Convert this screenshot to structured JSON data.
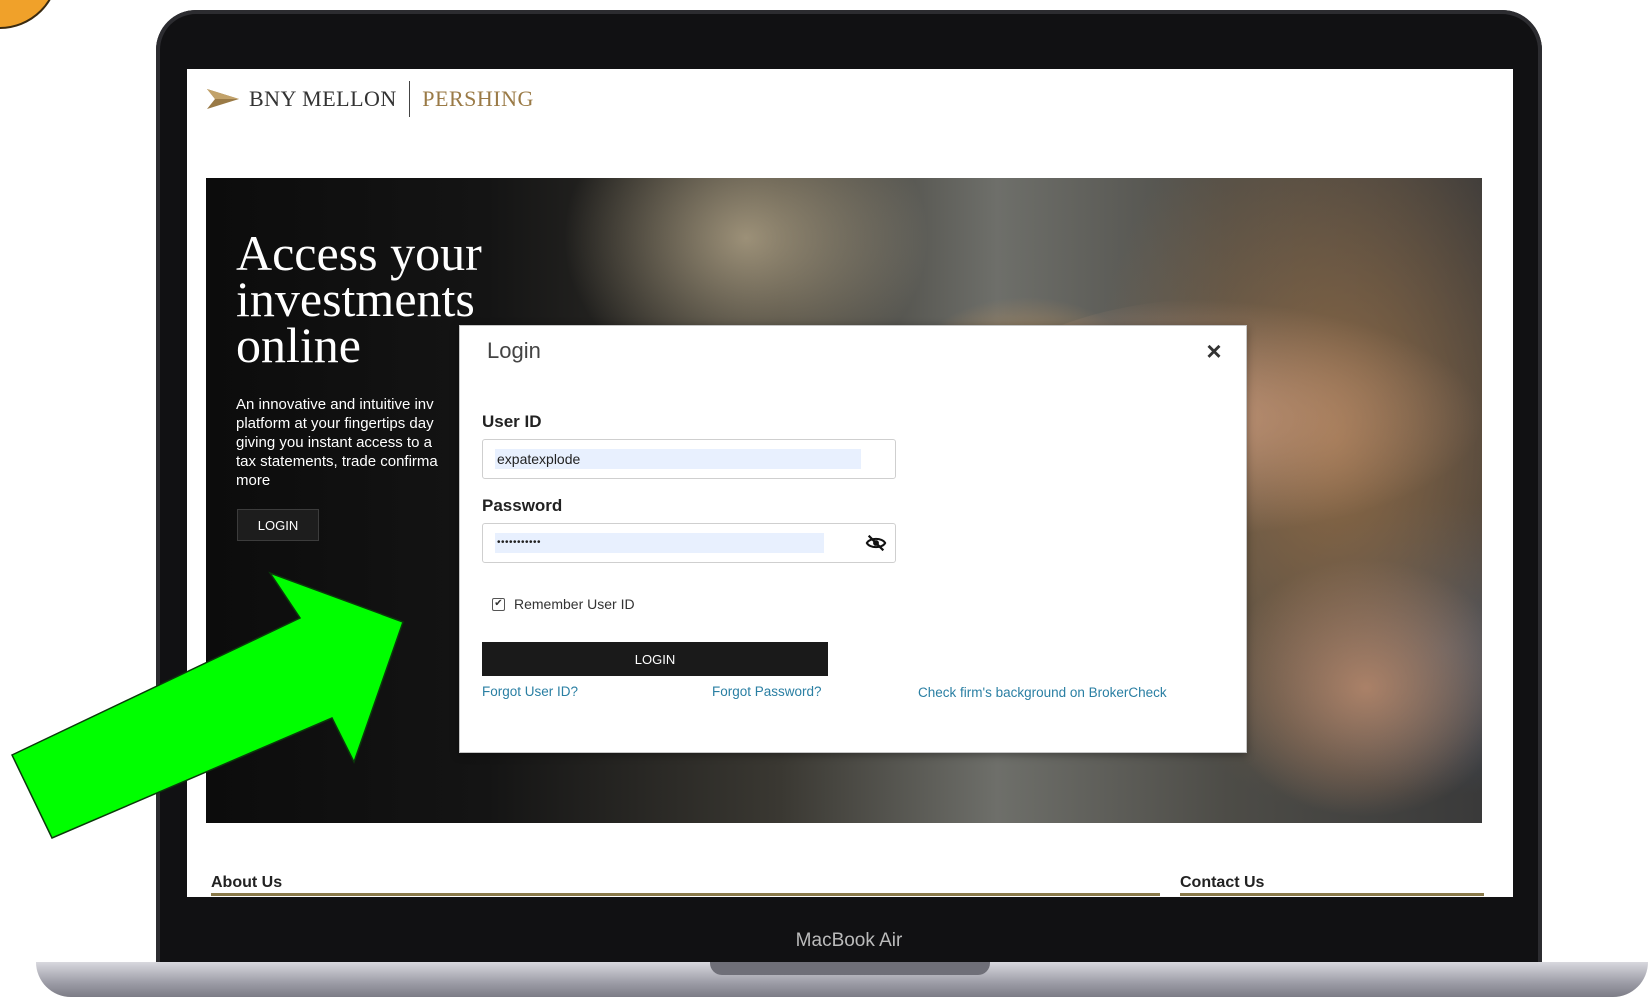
{
  "device": {
    "label": "MacBook Air"
  },
  "logo": {
    "primary": "BNY MELLON",
    "secondary": "PERSHING",
    "mark_icon": "bny-mellon-arrow-mark"
  },
  "hero": {
    "title_line1": "Access your",
    "title_line2": "investments",
    "title_line3": "online",
    "description_lines": [
      "An innovative and intuitive inv",
      "platform at your fingertips day",
      "giving you instant access to a",
      "tax statements, trade confirma",
      "more"
    ],
    "login_label": "LOGIN"
  },
  "login_modal": {
    "title": "Login",
    "close_icon": "close-icon",
    "user_id": {
      "label": "User ID",
      "value": "expatexplode"
    },
    "password": {
      "label": "Password",
      "value": "•••••••••••",
      "toggle_icon": "eye-slash-icon"
    },
    "remember": {
      "label": "Remember User ID",
      "checked": true
    },
    "login_button": "LOGIN",
    "forgot_user_id": "Forgot User ID?",
    "forgot_password": "Forgot Password?",
    "brokercheck": "Check firm's background on BrokerCheck"
  },
  "footer": {
    "about": "About Us",
    "contact": "Contact Us"
  },
  "colors": {
    "accent_gold": "#9a7a46",
    "link": "#2a7fa3",
    "arrow": "#00ff00",
    "button_dark": "#1a1a1a"
  }
}
